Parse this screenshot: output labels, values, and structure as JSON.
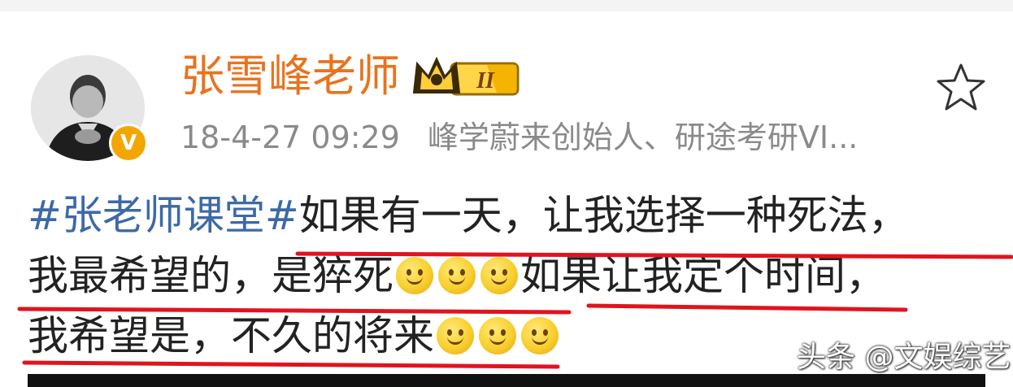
{
  "post": {
    "author": {
      "name": "张雪峰老师",
      "verified_icon": "verified-v-icon",
      "vip_level": "II",
      "vip_badge_icon": "crown-icon"
    },
    "timestamp": "18-4-27 09:29",
    "description": "峰学蔚来创始人、研途考研VI...",
    "follow_icon": "star-icon",
    "hashtag": "#张老师课堂#",
    "lines": {
      "l1": "如果有一天，让我选择一种死法，",
      "l2a": "我最希望的，是猝死",
      "l2b": "如果让我定个时间，",
      "l3": "我希望是，不久的将来"
    },
    "emoji_icon": "smile-emoji",
    "watermark": "头条 @文娱综艺",
    "colors": {
      "username": "#e8731f",
      "hashtag": "#3d69a6",
      "underline": "#e0141e",
      "text": "#222222",
      "meta": "#8a8a8a"
    }
  }
}
